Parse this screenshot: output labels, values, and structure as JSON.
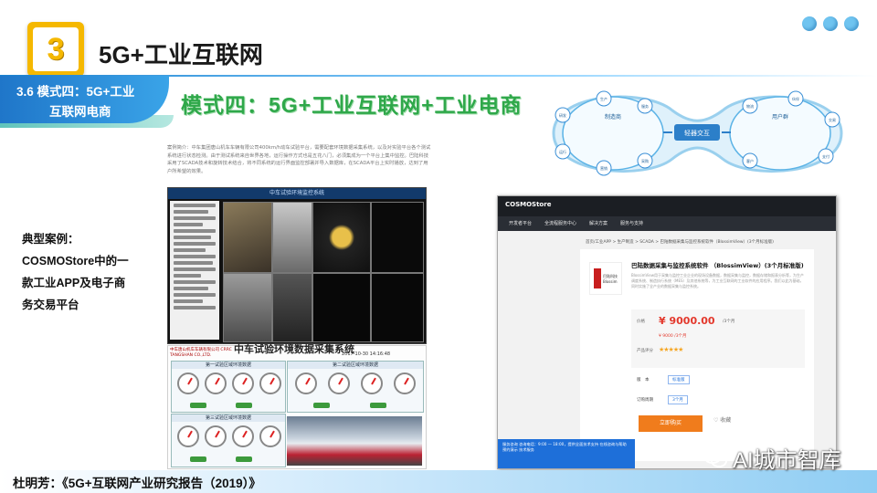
{
  "header": {
    "section_number": "3",
    "title": "5G+工业互联网"
  },
  "section_banner": {
    "line1": "3.6 模式四：5G+工业",
    "line2": "互联网电商"
  },
  "headline": "模式四：5G+工业互联网+工业电商",
  "case_study": {
    "label_line1": "典型案例：",
    "label_line2": "COSMOStore中的一",
    "label_line3": "款工业APP及电子商",
    "label_line4": "务交易平台"
  },
  "description": "案例简介：中车集团唐山机车车辆有限公司400km/h动车试验平台，需要配套环境数据采集系统，以及对实验平台各个测试系统进行状态检测。由于测试系统来自世界各地，运行操作方式也是五花八门，必须集成为一个平台上集中监控。巴陆科技采用了SCADA技术和旋转技术结合，将不同系统的运行界面监控部署并导入数据库，在SCADA平台上实时播放，达到了用户所希望的效果。",
  "scada_top": {
    "title": "中车试验环境监控系统"
  },
  "scada_bottom": {
    "title": "中车试验环境数据采集系统",
    "company": "中车唐山机车车辆有限公司 CRRC TANGSHAN CO.,LTD.",
    "timestamp": "2017-10-30 14:16:48",
    "panel1": "第一试验区域环境数据",
    "panel2": "第二试验区域环境数据",
    "panel3": "第三试验区域环境数据"
  },
  "diagram": {
    "center_label": "轻器交互",
    "left_group": "制造商",
    "right_group": "用户群",
    "nodes": [
      "研发",
      "运行",
      "生产",
      "营销",
      "服务",
      "采购",
      "物流",
      "客户",
      "伙伴",
      "交易",
      "支付"
    ]
  },
  "store": {
    "logo": "COSMOStore",
    "nav": [
      "开发者平台",
      "全流程服务中心",
      "解决方案",
      "服务与支持"
    ],
    "breadcrumb": "首页/工业APP > 生产制造 > SCADA > 巴陆数据采集与监控系统软件（BlossimView）(3个月标准版)",
    "product_name": "巴陆数据采集与监控系统软件 （BlossimView）(3个月标准版)",
    "product_desc": "BlossimView用于采集与监控工业企业的现场设备数据，数据采集与监控，数据存储和报表分析等，为生产调度系统、制造执行系统（MES）及其他系统等，为工业互联网的工业软件的应用程序。我们以此为基础，同时实施了全产业的数据采集与监控系统。",
    "vendor_thumb": "巴陆科技 Blossim",
    "price_label": "价格",
    "price": "¥ 9000.00",
    "price_unit": "/3个月",
    "price_sub": "¥ 9000 /3个月",
    "rating_label": "产品评分",
    "stars": "★★★★★",
    "version_label": "版　本",
    "version_value": "标准版",
    "duration_label": "订购周期",
    "duration_value": "3个月",
    "buy_button": "立即购买",
    "fav_button": "♡ 收藏",
    "chat_text": "服务咨询 咨询电话：9:00 — 18:00，提供全面技术支持 在线咨询与帮助 预约演示 技术服务"
  },
  "footer": "杜明芳：《5G+互联网产业研究报告（2019）》",
  "watermark": "AI城市智库"
}
